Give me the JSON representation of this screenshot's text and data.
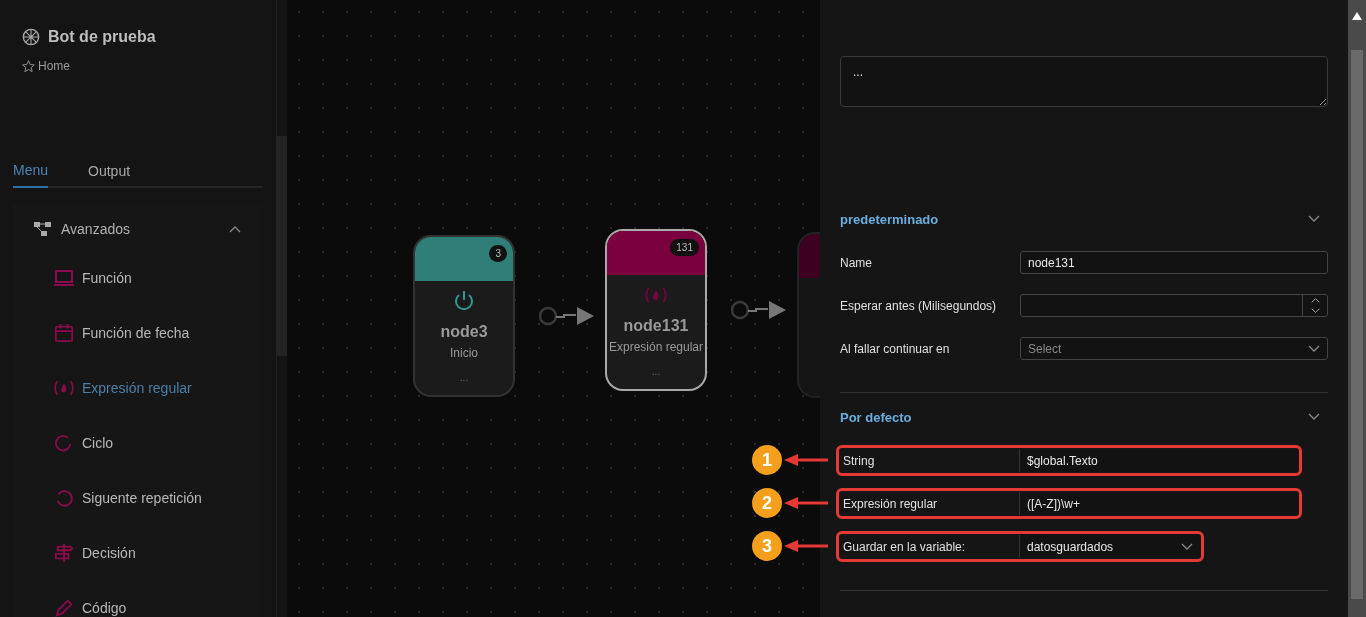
{
  "sidebar": {
    "title": "Bot de prueba",
    "breadcrumb": "Home",
    "tabs": [
      {
        "label": "Menu",
        "selected": true
      },
      {
        "label": "Output",
        "selected": false
      }
    ],
    "group": {
      "label": "Avanzados",
      "expanded": true,
      "items": [
        {
          "label": "Función",
          "kind": "laptop",
          "selected": false
        },
        {
          "label": "Función de fecha",
          "kind": "calendar",
          "selected": false
        },
        {
          "label": "Expresión regular",
          "kind": "regex",
          "selected": true
        },
        {
          "label": "Ciclo",
          "kind": "redo",
          "selected": false
        },
        {
          "label": "Siguente repetición",
          "kind": "undo",
          "selected": false
        },
        {
          "label": "Decisión",
          "kind": "signpost",
          "selected": false
        },
        {
          "label": "Código",
          "kind": "code",
          "selected": false
        }
      ]
    }
  },
  "canvas": {
    "nodes": [
      {
        "name": "node3",
        "type": "Inicio",
        "badge": "3",
        "footer": "...",
        "kind": "power",
        "color": "#2f7f78",
        "selected": false
      },
      {
        "name": "node131",
        "type": "Expresión regular",
        "badge": "131",
        "footer": "...",
        "kind": "regex",
        "color": "#7a0040",
        "selected": true
      }
    ]
  },
  "panel": {
    "notes": {
      "value": "..."
    },
    "sections": [
      {
        "title": "predeterminado",
        "expanded": true,
        "fields": [
          {
            "label": "Name",
            "kind": "text",
            "value": "node131"
          },
          {
            "label": "Esperar antes (Milisegundos)",
            "kind": "number"
          },
          {
            "label": "Al fallar continuar en",
            "kind": "select",
            "placeholder": "Select"
          }
        ]
      },
      {
        "title": "Por defecto",
        "expanded": true,
        "fields": [
          {
            "label": "String",
            "kind": "text",
            "value": "$global.Texto",
            "callout": "1"
          },
          {
            "label": "Expresión regular",
            "kind": "text",
            "value": "([A-Z])\\w+",
            "callout": "2"
          },
          {
            "label": "Guardar en la variable:",
            "kind": "select",
            "value": "datosguardados",
            "callout": "3"
          }
        ]
      }
    ]
  }
}
